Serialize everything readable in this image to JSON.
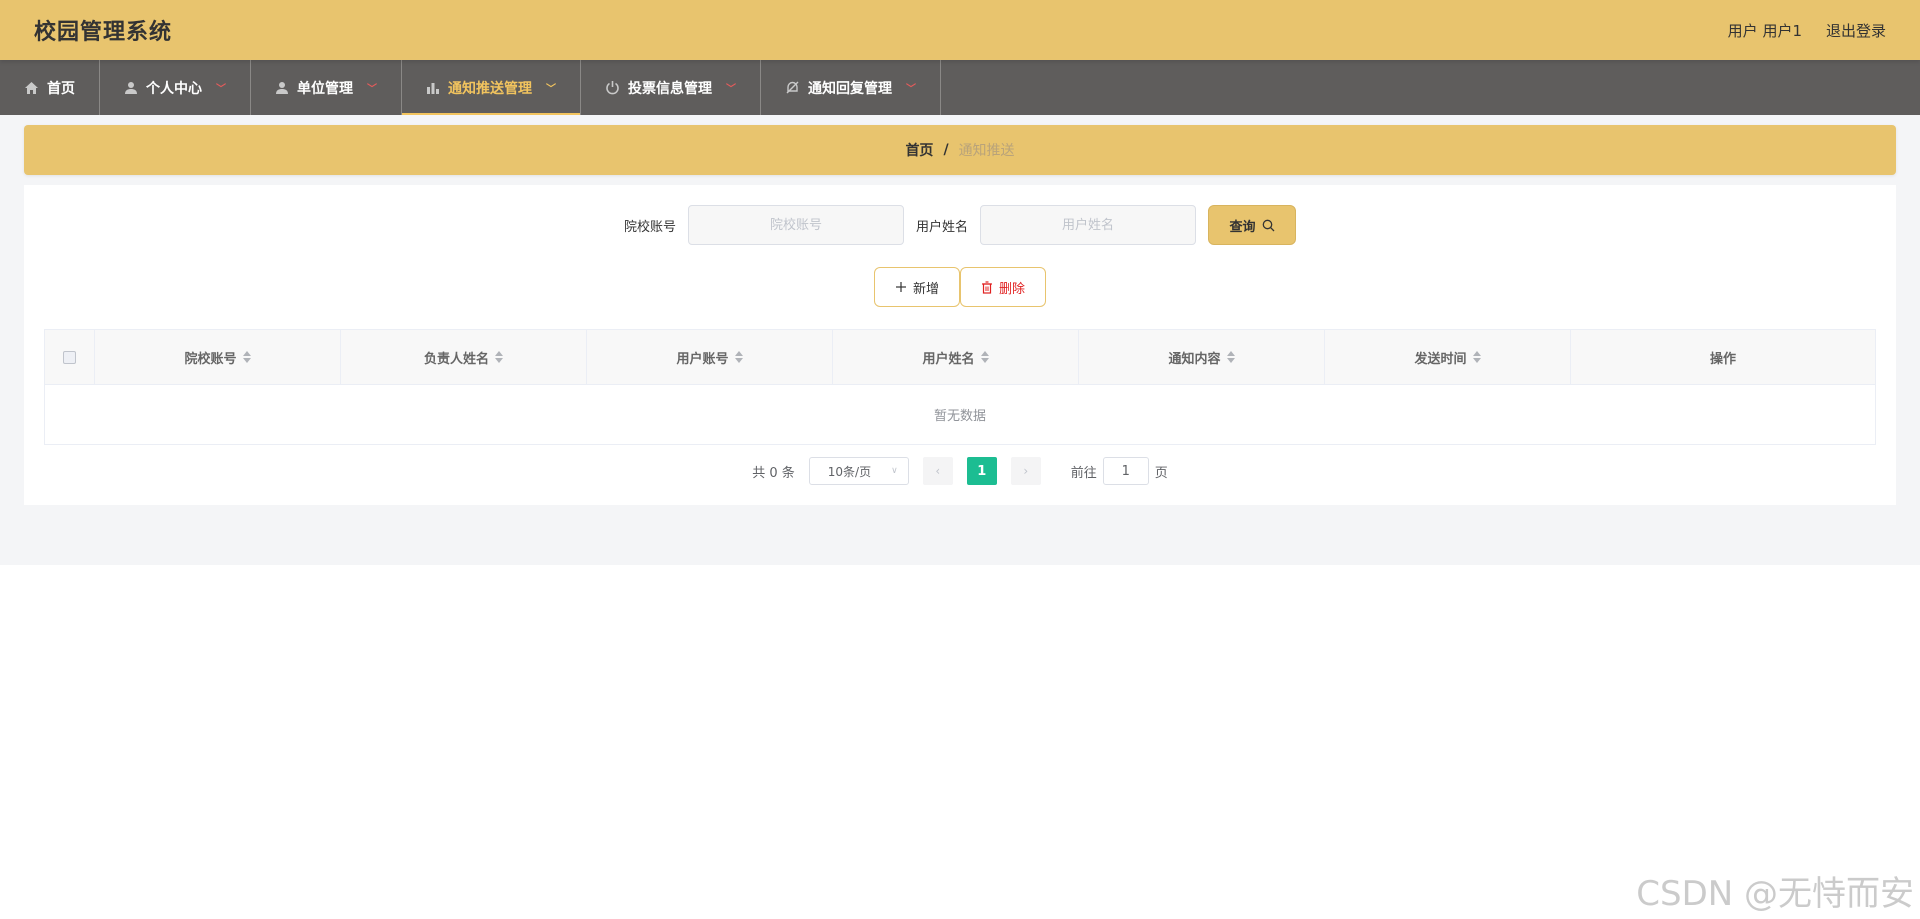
{
  "header": {
    "title": "校园管理系统",
    "user_label": "用户 用户1",
    "logout_label": "退出登录"
  },
  "nav": {
    "items": [
      {
        "label": "首页",
        "icon": "home-icon"
      },
      {
        "label": "个人中心",
        "icon": "user-icon"
      },
      {
        "label": "单位管理",
        "icon": "user-icon"
      },
      {
        "label": "通知推送管理",
        "icon": "bar-chart-icon"
      },
      {
        "label": "投票信息管理",
        "icon": "power-icon"
      },
      {
        "label": "通知回复管理",
        "icon": "bell-off-icon"
      }
    ],
    "active_index": 3
  },
  "breadcrumb": {
    "home": "首页",
    "separator": "/",
    "current": "通知推送"
  },
  "search": {
    "school_account_label": "院校账号",
    "school_account_placeholder": "院校账号",
    "school_account_value": "",
    "user_name_label": "用户姓名",
    "user_name_placeholder": "用户姓名",
    "user_name_value": "",
    "query_label": "查询"
  },
  "actions": {
    "add_label": "新增",
    "delete_label": "删除"
  },
  "table": {
    "columns": [
      "院校账号",
      "负责人姓名",
      "用户账号",
      "用户姓名",
      "通知内容",
      "发送时间"
    ],
    "ops_label": "操作",
    "empty_text": "暂无数据",
    "rows": []
  },
  "pagination": {
    "total_text": "共 0 条",
    "page_size": "10条/页",
    "current_page": "1",
    "goto_prefix": "前往",
    "goto_value": "1",
    "goto_suffix": "页"
  },
  "watermark": "CSDN @无恃而安",
  "colors": {
    "header_bg": "#E8C46E",
    "nav_bg": "#5F5D5C",
    "nav_active": "#F2C45E",
    "page_active": "#1CBD92",
    "danger": "#e02020"
  }
}
